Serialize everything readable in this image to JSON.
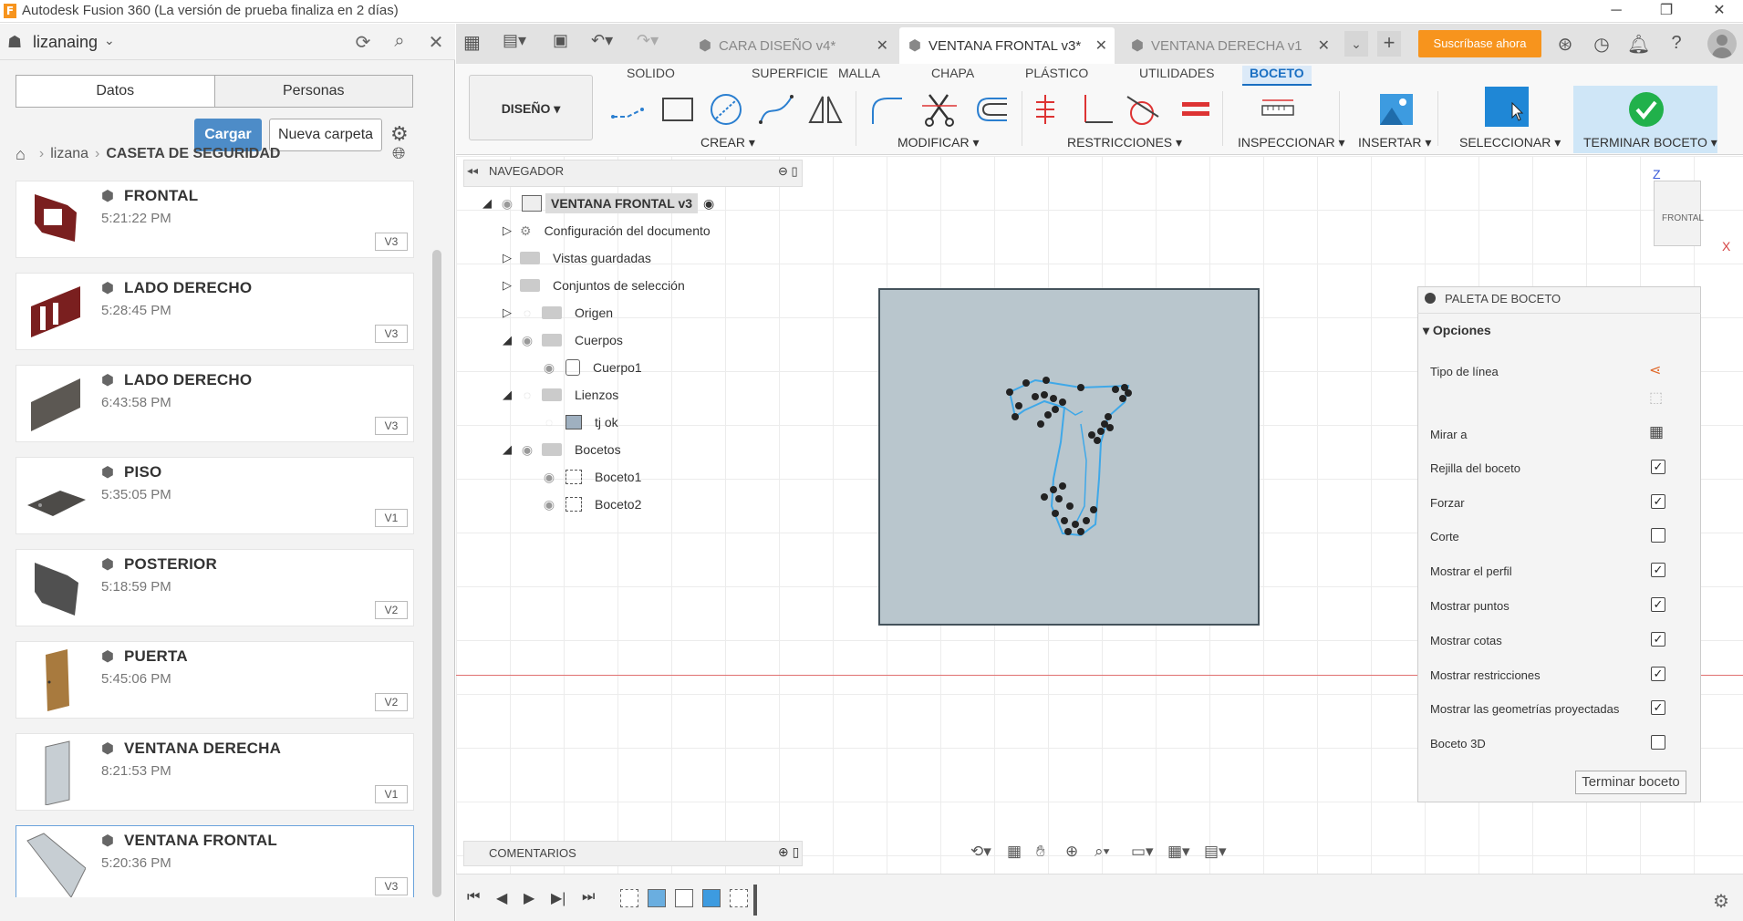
{
  "window": {
    "title": "Autodesk Fusion 360 (La versión de prueba finaliza en 2 días)"
  },
  "left_panel": {
    "user": "lizanaing",
    "tabs": [
      "Datos",
      "Personas"
    ],
    "upload_label": "Cargar",
    "new_folder_label": "Nueva carpeta",
    "breadcrumb": {
      "user": "lizana",
      "project": "CASETA DE SEGURIDAD"
    },
    "files": [
      {
        "name": "FRONTAL",
        "time": "5:21:22 PM",
        "version": "V3"
      },
      {
        "name": "LADO DERECHO",
        "time": "5:28:45 PM",
        "version": "V3"
      },
      {
        "name": "LADO DERECHO",
        "time": "6:43:58 PM",
        "version": "V3"
      },
      {
        "name": "PISO",
        "time": "5:35:05 PM",
        "version": "V1"
      },
      {
        "name": "POSTERIOR",
        "time": "5:18:59 PM",
        "version": "V2"
      },
      {
        "name": "PUERTA",
        "time": "5:45:06 PM",
        "version": "V2"
      },
      {
        "name": "VENTANA DERECHA",
        "time": "8:21:53 PM",
        "version": "V1"
      },
      {
        "name": "VENTANA FRONTAL",
        "time": "5:20:36 PM",
        "version": "V3"
      }
    ]
  },
  "doc_tabs": [
    {
      "label": "CARA DISEÑO v4*",
      "active": false
    },
    {
      "label": "VENTANA FRONTAL v3*",
      "active": true
    },
    {
      "label": "VENTANA DERECHA v1",
      "active": false
    }
  ],
  "subscribe_label": "Suscríbase ahora",
  "toolbar": {
    "workspace": "DISEÑO",
    "workspace_tabs": [
      "SOLIDO",
      "SUPERFICIE",
      "MALLA",
      "CHAPA",
      "PLÁSTICO",
      "UTILIDADES",
      "BOCETO"
    ],
    "active_tab": "BOCETO",
    "groups": [
      "CREAR",
      "MODIFICAR",
      "RESTRICCIONES",
      "INSPECCIONAR",
      "INSERTAR",
      "SELECCIONAR",
      "TERMINAR BOCETO"
    ]
  },
  "navigator": {
    "title": "NAVEGADOR",
    "root": "VENTANA FRONTAL v3",
    "items": [
      "Configuración del documento",
      "Vistas guardadas",
      "Conjuntos de selección",
      "Origen",
      "Cuerpos",
      "Cuerpo1",
      "Lienzos",
      "tj ok",
      "Bocetos",
      "Boceto1",
      "Boceto2"
    ]
  },
  "comments_label": "COMENTARIOS",
  "viewcube": {
    "label": "FRONTAL",
    "z": "Z",
    "x": "X"
  },
  "palette": {
    "title": "PALETA DE BOCETO",
    "section": "Opciones",
    "rows": [
      {
        "label": "Tipo de línea",
        "control": "icon"
      },
      {
        "label": "",
        "control": "icon"
      },
      {
        "label": "Mirar a",
        "control": "icon"
      },
      {
        "label": "Rejilla del boceto",
        "checked": true
      },
      {
        "label": "Forzar",
        "checked": true
      },
      {
        "label": "Corte",
        "checked": false
      },
      {
        "label": "Mostrar el perfil",
        "checked": true
      },
      {
        "label": "Mostrar puntos",
        "checked": true
      },
      {
        "label": "Mostrar cotas",
        "checked": true
      },
      {
        "label": "Mostrar restricciones",
        "checked": true
      },
      {
        "label": "Mostrar las geometrías proyectadas",
        "checked": true
      },
      {
        "label": "Boceto 3D",
        "checked": false
      }
    ],
    "finish_label": "Terminar boceto"
  },
  "colors": {
    "accent": "#1a6fc2",
    "subscribe": "#f7941d",
    "upload": "#4d8cc8"
  }
}
